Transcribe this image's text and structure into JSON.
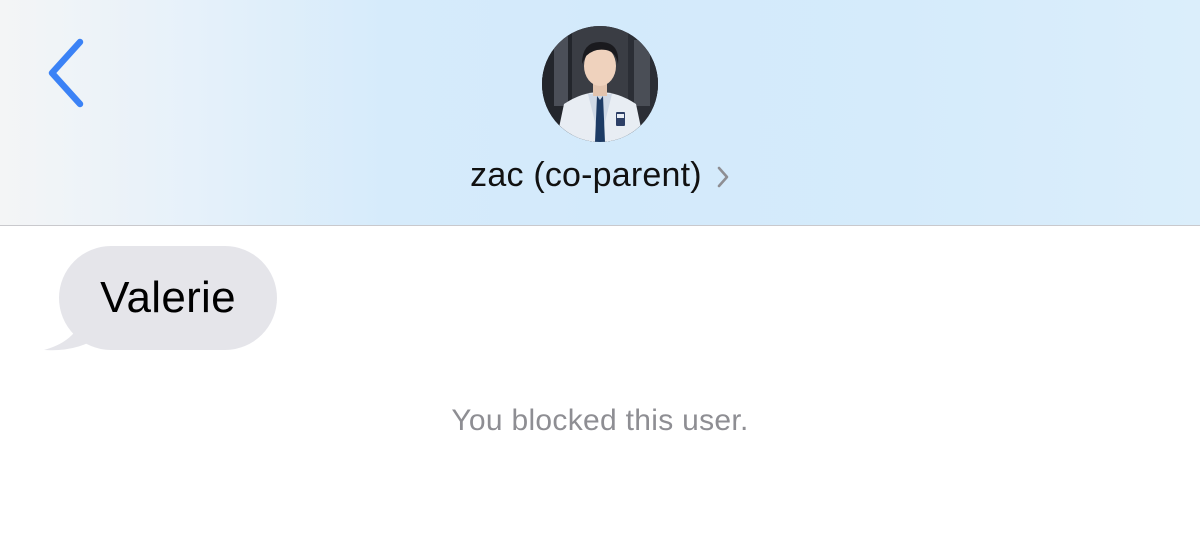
{
  "header": {
    "contact_name": "zac (co-parent)",
    "avatar": "contact-photo",
    "back_icon": "chevron-left-icon",
    "detail_icon": "chevron-right-icon",
    "accent_color": "#3b82f6"
  },
  "messages": [
    {
      "direction": "incoming",
      "text": "Valerie"
    }
  ],
  "status": {
    "blocked_note": "You blocked this user."
  },
  "colors": {
    "header_background": "#d3eafb",
    "bubble_incoming": "#e5e5ea",
    "note_text": "#8e8e93"
  }
}
